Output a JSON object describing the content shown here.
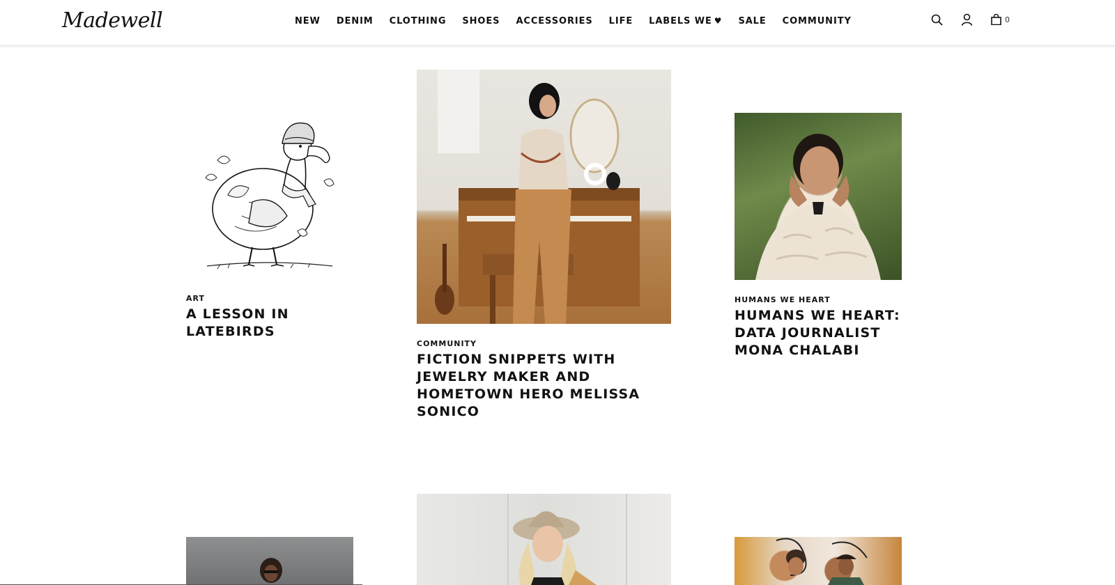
{
  "brand": {
    "logo": "Madewell"
  },
  "nav": {
    "items": [
      "NEW",
      "DENIM",
      "CLOTHING",
      "SHOES",
      "ACCESSORIES",
      "LIFE",
      "LABELS WE",
      "SALE",
      "COMMUNITY"
    ],
    "labels_heart": "♥"
  },
  "utils": {
    "bag_count": "0"
  },
  "articles": [
    {
      "category": "ART",
      "title": "A LESSON IN LATEBIRDS",
      "image": "dodo-illustration"
    },
    {
      "category": "COMMUNITY",
      "title": "FICTION SNIPPETS WITH JEWELRY MAKER AND HOMETOWN HERO MELISSA SONICO",
      "image": "woman-at-piano"
    },
    {
      "category": "HUMANS WE HEART",
      "title": "HUMANS WE HEART: DATA JOURNALIST MONA CHALABI",
      "image": "mona-chalabi-portrait"
    }
  ]
}
